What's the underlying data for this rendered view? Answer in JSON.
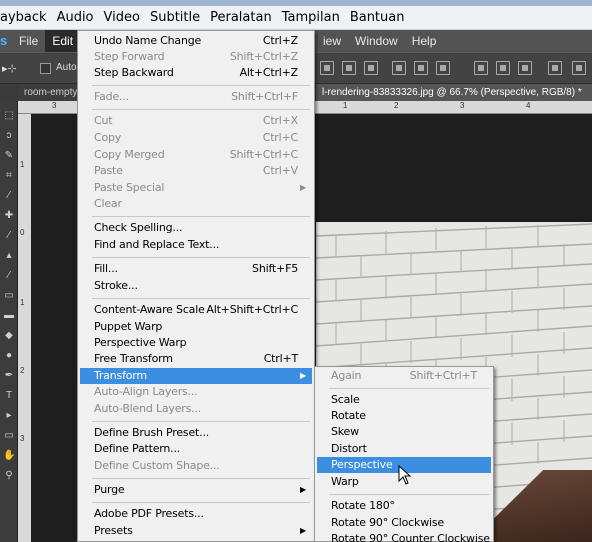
{
  "vlc_menubar": [
    "ayback",
    "Audio",
    "Video",
    "Subtitle",
    "Peralatan",
    "Tampilan",
    "Bantuan"
  ],
  "ps_logo": "s",
  "ps_menubar": {
    "left": [
      "File",
      "Edit"
    ],
    "right": [
      "iew",
      "Window",
      "Help"
    ]
  },
  "options": {
    "auto_label": "Auto-"
  },
  "tabs": {
    "doc1": "room-empty",
    "doc2": "l-rendering-83833326.jpg @ 66.7% (Perspective, RGB/8) *"
  },
  "ruler": {
    "h": [
      "3",
      "1",
      "2",
      "3",
      "4"
    ],
    "v": [
      "1",
      "0",
      "1",
      "2",
      "3"
    ]
  },
  "edit_menu": {
    "items": [
      {
        "label": "Undo Name Change",
        "shortcut": "Ctrl+Z",
        "state": "enabled"
      },
      {
        "label": "Step Forward",
        "shortcut": "Shift+Ctrl+Z",
        "state": "disabled"
      },
      {
        "label": "Step Backward",
        "shortcut": "Alt+Ctrl+Z",
        "state": "enabled"
      },
      {
        "label": "Fade...",
        "shortcut": "Shift+Ctrl+F",
        "state": "disabled"
      },
      {
        "label": "Cut",
        "shortcut": "Ctrl+X",
        "state": "disabled"
      },
      {
        "label": "Copy",
        "shortcut": "Ctrl+C",
        "state": "disabled"
      },
      {
        "label": "Copy Merged",
        "shortcut": "Shift+Ctrl+C",
        "state": "disabled"
      },
      {
        "label": "Paste",
        "shortcut": "Ctrl+V",
        "state": "disabled"
      },
      {
        "label": "Paste Special",
        "shortcut": "",
        "state": "disabled",
        "submenu": true
      },
      {
        "label": "Clear",
        "shortcut": "",
        "state": "disabled"
      },
      {
        "label": "Check Spelling...",
        "shortcut": "",
        "state": "enabled"
      },
      {
        "label": "Find and Replace Text...",
        "shortcut": "",
        "state": "enabled"
      },
      {
        "label": "Fill...",
        "shortcut": "Shift+F5",
        "state": "enabled"
      },
      {
        "label": "Stroke...",
        "shortcut": "",
        "state": "enabled"
      },
      {
        "label": "Content-Aware Scale",
        "shortcut": "Alt+Shift+Ctrl+C",
        "state": "enabled"
      },
      {
        "label": "Puppet Warp",
        "shortcut": "",
        "state": "enabled"
      },
      {
        "label": "Perspective Warp",
        "shortcut": "",
        "state": "enabled"
      },
      {
        "label": "Free Transform",
        "shortcut": "Ctrl+T",
        "state": "enabled"
      },
      {
        "label": "Transform",
        "shortcut": "",
        "state": "highlighted",
        "submenu": true
      },
      {
        "label": "Auto-Align Layers...",
        "shortcut": "",
        "state": "disabled"
      },
      {
        "label": "Auto-Blend Layers...",
        "shortcut": "",
        "state": "disabled"
      },
      {
        "label": "Define Brush Preset...",
        "shortcut": "",
        "state": "enabled"
      },
      {
        "label": "Define Pattern...",
        "shortcut": "",
        "state": "enabled"
      },
      {
        "label": "Define Custom Shape...",
        "shortcut": "",
        "state": "disabled"
      },
      {
        "label": "Purge",
        "shortcut": "",
        "state": "enabled",
        "submenu": true
      },
      {
        "label": "Adobe PDF Presets...",
        "shortcut": "",
        "state": "enabled"
      },
      {
        "label": "Presets",
        "shortcut": "",
        "state": "enabled",
        "submenu": true
      }
    ]
  },
  "transform_menu": {
    "items": [
      {
        "label": "Again",
        "shortcut": "Shift+Ctrl+T",
        "state": "disabled"
      },
      {
        "label": "Scale",
        "shortcut": "",
        "state": "enabled"
      },
      {
        "label": "Rotate",
        "shortcut": "",
        "state": "enabled"
      },
      {
        "label": "Skew",
        "shortcut": "",
        "state": "enabled"
      },
      {
        "label": "Distort",
        "shortcut": "",
        "state": "enabled"
      },
      {
        "label": "Perspective",
        "shortcut": "",
        "state": "highlighted"
      },
      {
        "label": "Warp",
        "shortcut": "",
        "state": "enabled"
      },
      {
        "label": "Rotate 180°",
        "shortcut": "",
        "state": "enabled"
      },
      {
        "label": "Rotate 90° Clockwise",
        "shortcut": "",
        "state": "enabled"
      },
      {
        "label": "Rotate 90° Counter Clockwise",
        "shortcut": "",
        "state": "enabled"
      }
    ]
  },
  "colors": {
    "highlight": "#3b8ee0",
    "menu_bg": "#f0f0f0",
    "ps_dark": "#535353"
  }
}
